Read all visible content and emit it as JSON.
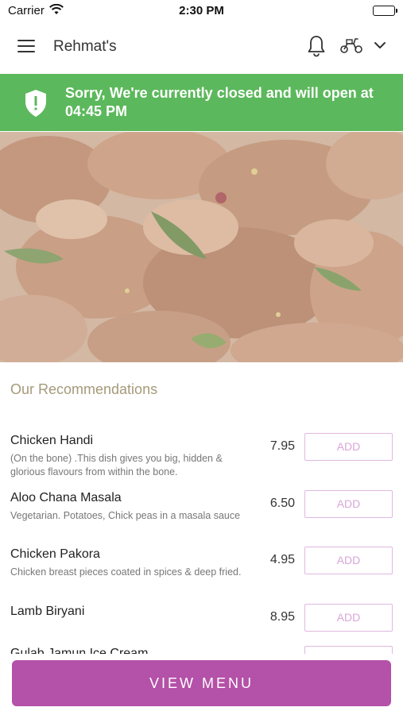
{
  "status_bar": {
    "carrier": "Carrier",
    "time": "2:30 PM"
  },
  "header": {
    "title": "Rehmat's",
    "icons": [
      "menu-icon",
      "bell-icon",
      "scooter-icon",
      "chevron-down-icon"
    ]
  },
  "banner": {
    "message": "Sorry, We're currently closed and will open at 04:45 PM",
    "color": "#5cb85c",
    "icon": "shield-icon"
  },
  "recommendations": {
    "title": "Our Recommendations",
    "items": [
      {
        "name": "Chicken Handi",
        "description": "(On the bone) .This dish gives you big, hidden & glorious flavours from within the bone.",
        "price": "7.95",
        "button": "ADD"
      },
      {
        "name": "Aloo Chana Masala",
        "description": "Vegetarian. Potatoes, Chick peas in a masala sauce",
        "price": "6.50",
        "button": "ADD"
      },
      {
        "name": "Chicken Pakora",
        "description": "Chicken breast pieces coated in spices & deep fried.",
        "price": "4.95",
        "button": "ADD"
      },
      {
        "name": "Lamb Biryani",
        "description": "",
        "price": "8.95",
        "button": "ADD"
      },
      {
        "name": "Gulab Jamun Ice Cream",
        "description": "",
        "price": "",
        "button": "ADD"
      }
    ]
  },
  "footer": {
    "view_menu_label": "VIEW MENU",
    "accent_color": "#b451a8"
  }
}
